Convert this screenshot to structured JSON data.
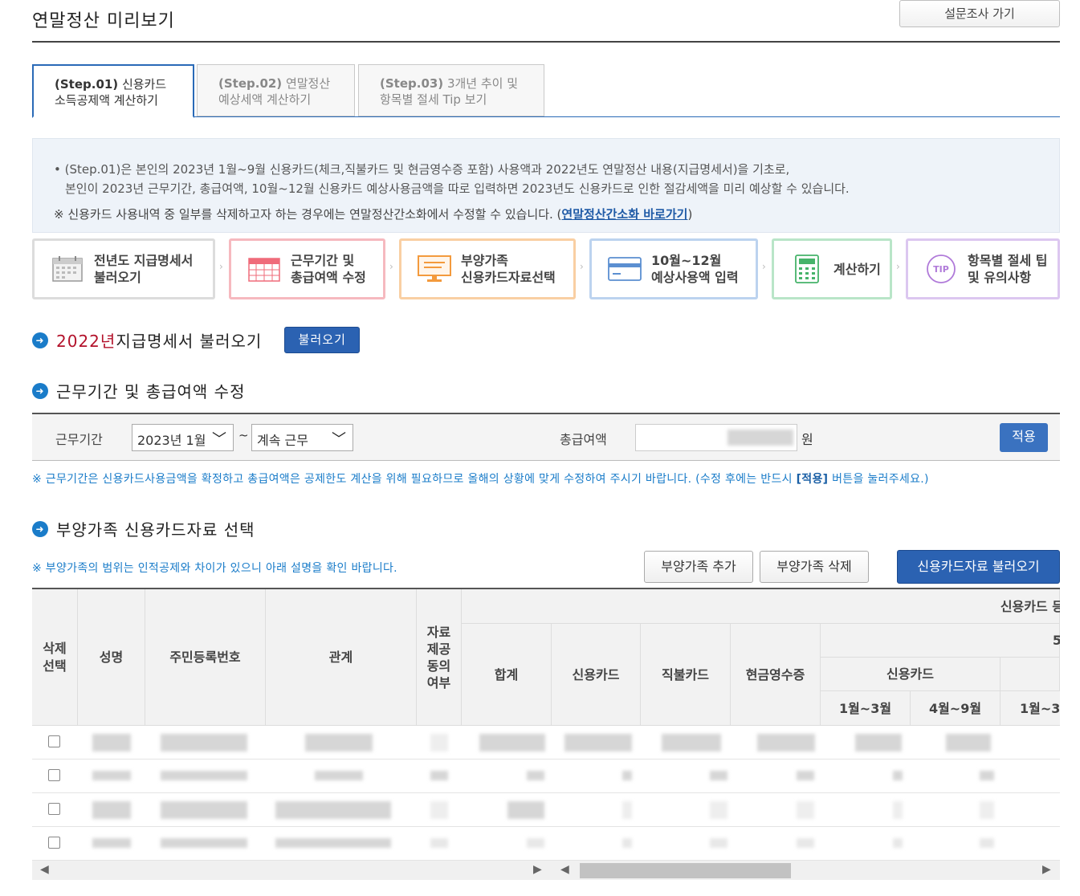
{
  "header": {
    "title": "연말정산 미리보기",
    "survey_button": "설문조사 가기"
  },
  "tabs": [
    {
      "step": "(Step.01)",
      "label1": " 신용카드",
      "label2": "소득공제액 계산하기"
    },
    {
      "step": "(Step.02)",
      "label1": " 연말정산",
      "label2": "예상세액 계산하기"
    },
    {
      "step": "(Step.03)",
      "label1": " 3개년 추이 및",
      "label2": "항목별 절세 Tip 보기"
    }
  ],
  "info": {
    "line1": "• (Step.01)은 본인의 2023년 1월~9월 신용카드(체크,직불카드 및 현금영수증 포함) 사용액과 2022년도 연말정산 내용(지급명세서)을 기초로,",
    "line2": "본인이 2023년 근무기간, 총급여액, 10월~12월 신용카드 예상사용금액을 따로 입력하면 2023년도 신용카드로 인한 절감세액을 미리 예상할 수 있습니다.",
    "note": "※ 신용카드 사용내역 중 일부를 삭제하고자 하는 경우에는 연말정산간소화에서 수정할 수 있습니다. (",
    "link": "연말정산간소화 바로가기",
    "note_end": ")"
  },
  "steps": [
    {
      "l1": "전년도 지급명세서",
      "l2": "불러오기",
      "icon": "calendar-icon"
    },
    {
      "l1": "근무기간 및",
      "l2": "총급여액 수정",
      "icon": "calendar-grid-icon"
    },
    {
      "l1": "부양가족",
      "l2": "신용카드자료선택",
      "icon": "monitor-icon"
    },
    {
      "l1": "10월~12월",
      "l2": "예상사용액 입력",
      "icon": "credit-card-icon"
    },
    {
      "l1": "계산하기",
      "l2": "",
      "icon": "calculator-icon"
    },
    {
      "l1": "항목별 절세 팁",
      "l2": "및 유의사항",
      "icon": "tip-icon"
    }
  ],
  "section1": {
    "year": "2022년",
    "title": " 지급명세서 불러오기",
    "button": "불러오기"
  },
  "section2": {
    "title": "근무기간 및 총급여액 수정",
    "period_label": "근무기간",
    "start_value": "2023년 1월",
    "tilde": "~",
    "end_value": "계속 근무",
    "amount_label": "총급여액",
    "unit": "원",
    "apply": "적용",
    "notice_a": "※ 근무기간은 신용카드사용금액을 확정하고 총급여액은 공제한도 계산을 위해 필요하므로 올해의 상황에 맞게 수정하여 주시기 바랍니다. (수정 후에는 반드시 ",
    "notice_b": "[적용]",
    "notice_c": " 버튼을 눌러주세요.)"
  },
  "section3": {
    "title": "부양가족 신용카드자료 선택",
    "notice": "※ 부양가족의 범위는 인적공제와 차이가 있으니 아래 설명을 확인 바랍니다.",
    "add": "부양가족 추가",
    "delete": "부양가족 삭제",
    "load": "신용카드자료 불러오기"
  },
  "table": {
    "headers": {
      "del1": "삭제",
      "del2": "선택",
      "name": "성명",
      "rrn": "주민등록번호",
      "rel": "관계",
      "consent1": "자료",
      "consent2": "제공",
      "consent3": "동의",
      "consent4": "여부",
      "group": "신용카드 등",
      "sub5": "5",
      "total": "합계",
      "credit": "신용카드",
      "debit": "직불카드",
      "cash": "현금영수증",
      "credit2": "신용카드",
      "m13": "1월~3월",
      "m49": "4월~9월",
      "m13b": "1월~3"
    },
    "row_count": 4
  }
}
